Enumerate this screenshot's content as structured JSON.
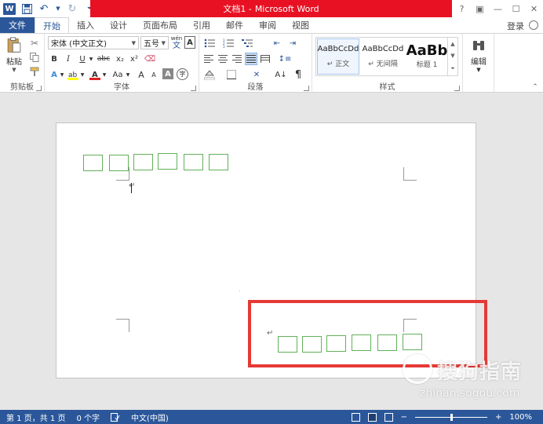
{
  "titlebar": {
    "title_doc": "文档1 -",
    "title_app": "Microsoft Word",
    "help": "?",
    "ribbon_display": "▣",
    "minimize": "—",
    "maximize": "☐",
    "close": "✕"
  },
  "qat": {
    "word_logo": "W",
    "save_icon": "save-icon",
    "undo_icon": "undo-icon",
    "redo_icon": "redo-icon",
    "customize_icon": "chevron-down-icon"
  },
  "tabs": [
    {
      "label": "文件"
    },
    {
      "label": "开始"
    },
    {
      "label": "插入"
    },
    {
      "label": "设计"
    },
    {
      "label": "页面布局"
    },
    {
      "label": "引用"
    },
    {
      "label": "邮件"
    },
    {
      "label": "审阅"
    },
    {
      "label": "视图"
    }
  ],
  "account": {
    "login_label": "登录"
  },
  "clipboard": {
    "paste_label": "粘贴",
    "group_label": "剪贴板"
  },
  "font": {
    "font_name": "宋体 (中文正文)",
    "font_size": "五号",
    "phonetic": "wén",
    "phonetic_char": "文",
    "bold": "B",
    "italic": "I",
    "underline": "U",
    "strike": "abc",
    "subscript": "x₂",
    "superscript": "x²",
    "grow": "A",
    "shrink": "A",
    "case": "Aa",
    "enclose": "字",
    "group_label": "字体"
  },
  "paragraph": {
    "group_label": "段落"
  },
  "styles": {
    "items": [
      {
        "preview": "AaBbCcDd",
        "name": "↵ 正文"
      },
      {
        "preview": "AaBbCcDd",
        "name": "↵ 无间隔"
      },
      {
        "preview": "AaBb",
        "name": "标题 1"
      }
    ],
    "group_label": "样式"
  },
  "editing": {
    "label": "编辑"
  },
  "document": {
    "para_mark_1": "↵",
    "para_mark_2": "↵",
    "top_boxes": 6,
    "bottom_boxes": 6
  },
  "watermark": {
    "text": "搜狗指南",
    "url": "zhinan.sogou.com"
  },
  "statusbar": {
    "page": "第 1 页，共 1 页",
    "words": "0 个字",
    "language": "中文(中国)",
    "zoom_minus": "−",
    "zoom_plus": "+",
    "zoom_level": "100%",
    "zoom_fraction": 0.5
  }
}
